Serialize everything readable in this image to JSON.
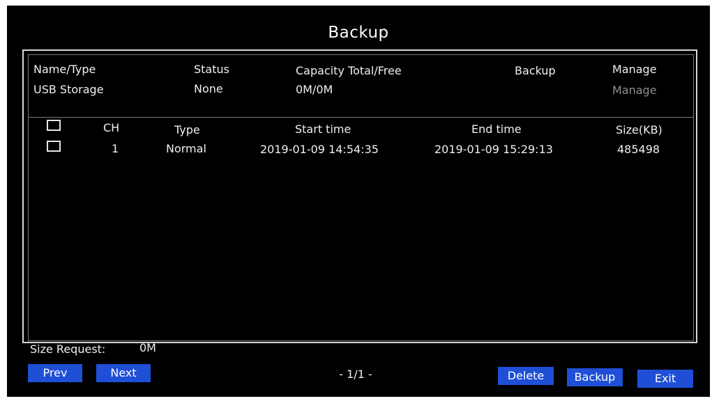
{
  "title": "Backup",
  "device_table": {
    "headers": {
      "name_type": "Name/Type",
      "status": "Status",
      "capacity": "Capacity Total/Free",
      "backup": "Backup",
      "manage": "Manage"
    },
    "row": {
      "name_type": "USB Storage",
      "status": "None",
      "capacity": "0M/0M",
      "manage": "Manage"
    }
  },
  "file_table": {
    "headers": {
      "ch": "CH",
      "type": "Type",
      "start_time": "Start time",
      "end_time": "End time",
      "size": "Size(KB)"
    },
    "rows": [
      {
        "ch": "1",
        "type": "Normal",
        "start_time": "2019-01-09 14:54:35",
        "end_time": "2019-01-09 15:29:13",
        "size": "485498"
      }
    ]
  },
  "footer": {
    "size_request_label": "Size Request:",
    "size_request_value": "0M",
    "page_indicator": "- 1/1 -",
    "prev_label": "Prev",
    "next_label": "Next",
    "delete_label": "Delete",
    "backup_label": "Backup",
    "exit_label": "Exit"
  },
  "colors": {
    "background": "#000000",
    "button": "#1f4fd6",
    "text": "#f0f0f0",
    "disabled_text": "#8f8f8f"
  }
}
